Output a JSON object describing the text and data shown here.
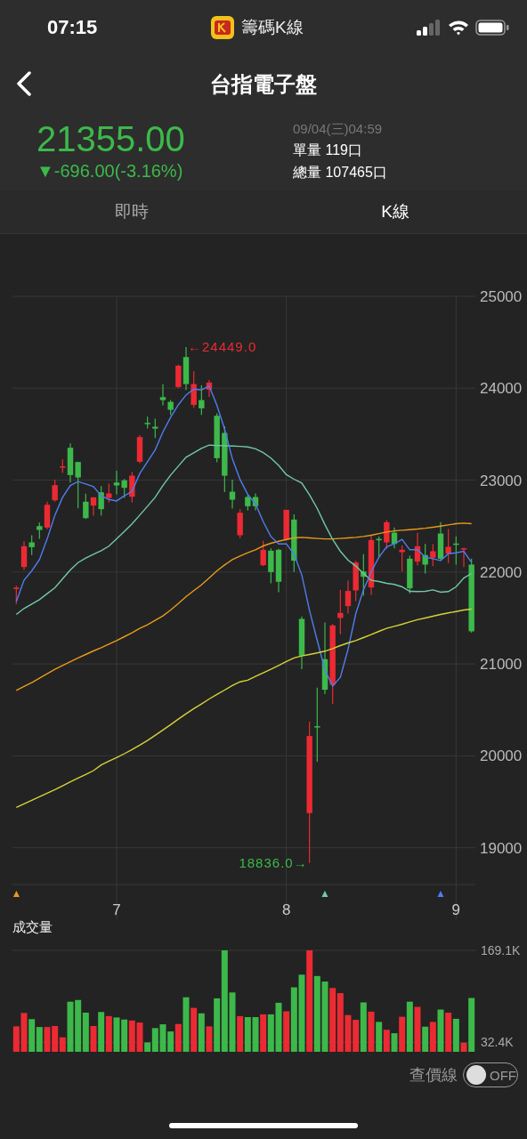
{
  "status_bar": {
    "time": "07:15",
    "app_title": "籌碼K線"
  },
  "nav": {
    "title": "台指電子盤"
  },
  "quote": {
    "price": "21355.00",
    "change": "▼-696.00(-3.16%)",
    "datetime": "09/04(三)04:59",
    "single_volume": "單量 119口",
    "total_volume": "總量 107465口"
  },
  "tabs": [
    {
      "label": "即時",
      "selected": false
    },
    {
      "label": "K線",
      "selected": true
    }
  ],
  "kline_chart": {
    "chart_data": {
      "type": "candlestick",
      "grid": true,
      "categories": [
        null,
        null,
        null,
        null,
        null,
        null,
        null,
        null,
        null,
        null,
        null,
        null,
        null,
        "7",
        null,
        null,
        null,
        null,
        null,
        null,
        null,
        null,
        null,
        null,
        null,
        null,
        null,
        null,
        null,
        null,
        null,
        null,
        null,
        null,
        null,
        "8",
        null,
        null,
        null,
        null,
        null,
        null,
        null,
        null,
        null,
        null,
        null,
        null,
        null,
        null,
        null,
        null,
        null,
        null,
        null,
        null,
        null,
        "9",
        null,
        null
      ],
      "ylim": [
        18600,
        25000
      ],
      "yticks": [
        {
          "value": 19000,
          "label": "19000"
        },
        {
          "value": 20000,
          "label": "20000"
        },
        {
          "value": 21000,
          "label": "21000"
        },
        {
          "value": 22000,
          "label": "22000"
        },
        {
          "value": 23000,
          "label": "23000"
        },
        {
          "value": 24000,
          "label": "24000"
        },
        {
          "value": 25000,
          "label": "25000"
        }
      ],
      "ohlc": [
        [
          21820,
          21852,
          21652,
          21830
        ],
        [
          22055,
          22335,
          22023,
          22281
        ],
        [
          22323,
          22400,
          22184,
          22271
        ],
        [
          22500,
          22539,
          22361,
          22458
        ],
        [
          22484,
          22765,
          22465,
          22732
        ],
        [
          22781,
          23006,
          22765,
          22945
        ],
        [
          23140,
          23226,
          23077,
          23150
        ],
        [
          23352,
          23400,
          22974,
          23055
        ],
        [
          23197,
          23200,
          22694,
          23029
        ],
        [
          22765,
          22852,
          22577,
          22587
        ],
        [
          22723,
          22813,
          22613,
          22813
        ],
        [
          22868,
          22935,
          22613,
          22684
        ],
        [
          22806,
          22961,
          22755,
          22855
        ],
        [
          22974,
          23103,
          22845,
          22942
        ],
        [
          22997,
          23013,
          22806,
          22916
        ],
        [
          22819,
          23087,
          22755,
          23048
        ],
        [
          23200,
          23490,
          23184,
          23468
        ],
        [
          23623,
          23690,
          23561,
          23610
        ],
        [
          23581,
          23668,
          23458,
          23561
        ],
        [
          23903,
          24045,
          23813,
          23871
        ],
        [
          23852,
          23871,
          23710,
          23765
        ],
        [
          24013,
          24258,
          24000,
          24245
        ],
        [
          24339,
          24449,
          23981,
          24045
        ],
        [
          23819,
          24184,
          23787,
          24045
        ],
        [
          23871,
          24032,
          23710,
          23781
        ],
        [
          23984,
          24087,
          23903,
          24061
        ],
        [
          23700,
          23726,
          23194,
          23239
        ],
        [
          23513,
          23587,
          22871,
          23048
        ],
        [
          22874,
          23006,
          22690,
          22787
        ],
        [
          22400,
          22684,
          22368,
          22645
        ],
        [
          22816,
          22845,
          22671,
          22716
        ],
        [
          22816,
          22855,
          22671,
          22716
        ],
        [
          22074,
          22339,
          22065,
          22242
        ],
        [
          22232,
          22258,
          21877,
          22000
        ],
        [
          22242,
          22252,
          21781,
          21894
        ],
        [
          22355,
          22677,
          22339,
          22677
        ],
        [
          22571,
          22629,
          22000,
          22123
        ],
        [
          21490,
          21516,
          20942,
          21090
        ],
        [
          19377,
          20371,
          18836,
          20216
        ],
        [
          20323,
          20742,
          19935,
          20316
        ],
        [
          21052,
          21452,
          20671,
          20719
        ],
        [
          20774,
          21435,
          20565,
          21419
        ],
        [
          21500,
          21806,
          21323,
          21555
        ],
        [
          21629,
          21910,
          21548,
          21794
        ],
        [
          21800,
          22123,
          21684,
          22103
        ],
        [
          22006,
          22194,
          21742,
          21948
        ],
        [
          21832,
          22394,
          21748,
          22348
        ],
        [
          22361,
          22387,
          22161,
          22345
        ],
        [
          22323,
          22565,
          22252,
          22542
        ],
        [
          22429,
          22484,
          22258,
          22306
        ],
        [
          22216,
          22290,
          22006,
          22242
        ],
        [
          22145,
          22177,
          21765,
          21823
        ],
        [
          22113,
          22426,
          22071,
          22281
        ],
        [
          22184,
          22306,
          21984,
          22081
        ],
        [
          22155,
          22306,
          22065,
          22226
        ],
        [
          22419,
          22542,
          22123,
          22145
        ],
        [
          22200,
          22468,
          22097,
          22274
        ],
        [
          22310,
          22387,
          22081,
          22297
        ],
        [
          22245,
          22265,
          22055,
          22258
        ],
        [
          22081,
          22145,
          21339,
          21355
        ]
      ],
      "series": [
        {
          "type": "line",
          "color": "#e89a1c",
          "values": [
            20713,
            20755,
            20797,
            20845,
            20894,
            20942,
            20984,
            21023,
            21065,
            21103,
            21142,
            21177,
            21216,
            21255,
            21297,
            21339,
            21387,
            21426,
            21474,
            21523,
            21587,
            21658,
            21732,
            21797,
            21861,
            21935,
            22013,
            22077,
            22135,
            22174,
            22210,
            22242,
            22284,
            22313,
            22335,
            22355,
            22371,
            22377,
            22371,
            22365,
            22361,
            22361,
            22365,
            22371,
            22377,
            22387,
            22400,
            22419,
            22435,
            22448,
            22455,
            22461,
            22468,
            22477,
            22487,
            22500,
            22513,
            22526,
            22532,
            22526
          ]
        },
        {
          "type": "line",
          "color": "#72c9a4",
          "values": [
            21539,
            21603,
            21652,
            21700,
            21765,
            21829,
            21926,
            22023,
            22103,
            22152,
            22194,
            22232,
            22281,
            22361,
            22442,
            22523,
            22619,
            22716,
            22813,
            22942,
            23055,
            23152,
            23248,
            23297,
            23345,
            23381,
            23377,
            23374,
            23371,
            23368,
            23361,
            23340,
            23300,
            23240,
            23160,
            23060,
            23010,
            22968,
            22839,
            22694,
            22516,
            22355,
            22226,
            22129,
            22065,
            21984,
            21910,
            21897,
            21877,
            21865,
            21839,
            21790,
            21787,
            21790,
            21806,
            21781,
            21787,
            21839,
            21935,
            21984
          ]
        },
        {
          "type": "line",
          "color": "#4f7df0",
          "values": [
            21677,
            21910,
            22013,
            22135,
            22361,
            22619,
            22813,
            22942,
            22984,
            22958,
            22929,
            22829,
            22790,
            22774,
            22829,
            22877,
            23071,
            23200,
            23329,
            23523,
            23684,
            23819,
            23926,
            23990,
            23981,
            24023,
            23813,
            23555,
            23232,
            23006,
            22845,
            22742,
            22548,
            22387,
            22306,
            22306,
            22194,
            21968,
            21581,
            21258,
            20935,
            20758,
            20855,
            21161,
            21548,
            21806,
            22000,
            22161,
            22274,
            22306,
            22355,
            22242,
            22242,
            22161,
            22145,
            22123,
            22200,
            22210,
            22226,
            22103
          ]
        },
        {
          "type": "line",
          "color": "#d6d23a",
          "values": [
            19439,
            19477,
            19516,
            19555,
            19594,
            19632,
            19674,
            19716,
            19758,
            19797,
            19839,
            19900,
            19942,
            19981,
            20023,
            20068,
            20116,
            20168,
            20223,
            20281,
            20339,
            20400,
            20458,
            20513,
            20565,
            20619,
            20668,
            20716,
            20765,
            20806,
            20823,
            20865,
            20903,
            20942,
            20984,
            21026,
            21065,
            21087,
            21103,
            21119,
            21139,
            21168,
            21200,
            21229,
            21255,
            21287,
            21319,
            21355,
            21387,
            21410,
            21432,
            21458,
            21481,
            21500,
            21519,
            21539,
            21555,
            21571,
            21587,
            21597
          ]
        }
      ],
      "annotations": [
        "←24449.0",
        "18836.0→"
      ]
    },
    "signal_markers": [
      {
        "text": "▲",
        "color": "#e89a1c"
      },
      {
        "text": "▲",
        "color": "#72c9a4"
      },
      {
        "text": "▲",
        "color": "#4f7df0"
      }
    ]
  },
  "volume_chart": {
    "title": "成交量",
    "chart_data": {
      "type": "bar",
      "ylim": [
        18.5,
        169.1
      ],
      "yticks": [
        {
          "value": 32.4,
          "label": "32.4K"
        },
        {
          "value": 169.1,
          "label": "169.1K"
        }
      ],
      "values": [
        56.3,
        76.1,
        67.0,
        55.3,
        55.3,
        56.8,
        40.0,
        92.9,
        95.4,
        76.6,
        56.8,
        77.6,
        71.5,
        69.5,
        66.4,
        64.9,
        61.9,
        32.4,
        53.7,
        59.3,
        48.7,
        59.8,
        99.5,
        83.7,
        75.6,
        56.3,
        97.9,
        169.1,
        106.6,
        71.5,
        70.0,
        70.0,
        74.1,
        74.1,
        91.3,
        78.6,
        114.2,
        133.0,
        169.1,
        131.0,
        122.8,
        113.2,
        105.6,
        73.0,
        65.9,
        91.8,
        78.1,
        62.9,
        51.2,
        46.1,
        70.5,
        92.9,
        85.2,
        55.8,
        62.9,
        81.2,
        76.6,
        67.5,
        31.9,
        98.4
      ]
    }
  },
  "price_line_toggle": {
    "label": "查價線",
    "state_text": "OFF",
    "on": false
  }
}
